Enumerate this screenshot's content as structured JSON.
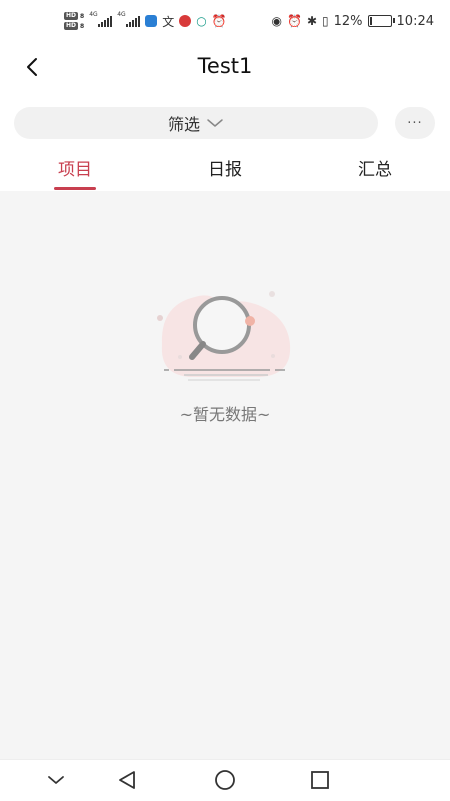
{
  "status_bar": {
    "network_left": "4G",
    "network_right": "4G",
    "battery_text": "12%",
    "battery_level": 0.12,
    "time": "10:24",
    "hd_label": "HD"
  },
  "header": {
    "title": "Test1",
    "back_icon": "chevron-left-icon"
  },
  "filter": {
    "label": "筛选",
    "more_label": "···"
  },
  "tabs": [
    {
      "label": "项目",
      "active": true
    },
    {
      "label": "日报",
      "active": false
    },
    {
      "label": "汇总",
      "active": false
    }
  ],
  "content": {
    "empty_text": "~暂无数据~"
  },
  "colors": {
    "accent": "#c83f4f",
    "content_bg": "#f5f5f5",
    "chip_bg": "#f1f1f1"
  },
  "nav_icons": [
    "chevron-down-icon",
    "back-triangle-icon",
    "home-circle-icon",
    "recent-square-icon"
  ]
}
